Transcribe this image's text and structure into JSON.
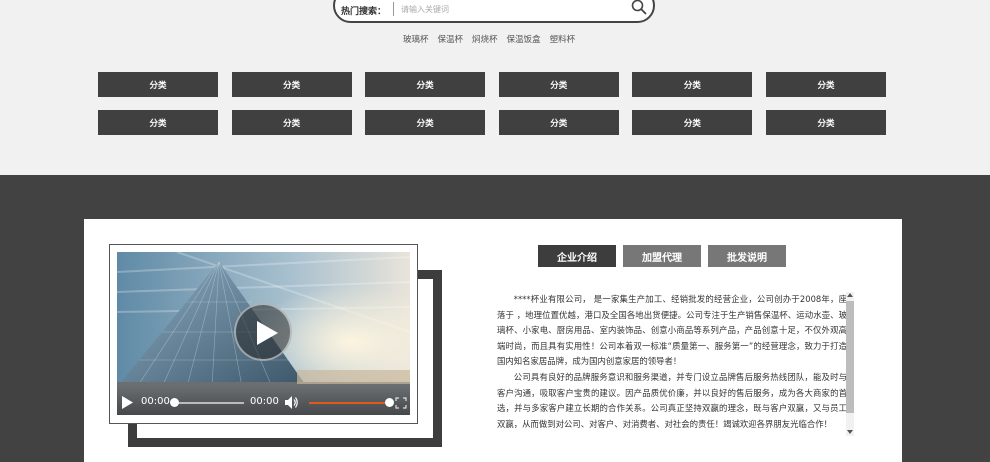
{
  "search": {
    "label": "热门搜索：",
    "placeholder": "请输入关键词",
    "hotwords": [
      "玻璃杯",
      "保温杯",
      "焖烧杯",
      "保温饭盒",
      "塑料杯"
    ]
  },
  "categories": {
    "rows": [
      [
        "分类",
        "分类",
        "分类",
        "分类",
        "分类",
        "分类"
      ],
      [
        "分类",
        "分类",
        "分类",
        "分类",
        "分类",
        "分类"
      ]
    ]
  },
  "video": {
    "current_time": "00:00",
    "duration": "00:00",
    "progress": 0,
    "volume": 1.0
  },
  "tabs": [
    {
      "label": "企业介绍",
      "active": true
    },
    {
      "label": "加盟代理",
      "active": false
    },
    {
      "label": "批发说明",
      "active": false
    }
  ],
  "intro": {
    "paragraphs": [
      "****杯业有限公司， 是一家集生产加工、经销批发的经营企业，公司创办于2008年，座落于 ，地理位置优越，港口及全国各地出货便捷。公司专注于生产销售保温杯、运动水壶、玻璃杯、小家电、厨房用品、室内装饰品、创意小商品等系列产品，产品创意十足，不仅外观高端时尚，而且具有实用性！公司本着双一标准“质量第一、服务第一”的经营理念，致力于打造国内知名家居品牌，成为国内创意家居的领导者！",
      "公司具有良好的品牌服务意识和服务渠道，并专门设立品牌售后服务热线团队，能及时与客户沟通，吸取客户宝贵的建议。因产品质优价廉，并以良好的售后服务，成为各大商家的首选，并与多家客户建立长期的合作关系。公司真正坚持双赢的理念，既与客户双赢，又与员工双赢，从而做到对公司、对客户、对消费者、对社会的责任！竭诚欢迎各界朋友光临合作！"
    ]
  },
  "colors": {
    "dark_bg": "#424242",
    "button_bg": "#404040",
    "tab_active": "#3d3d3d",
    "tab_inactive": "#777777",
    "volume_accent": "#e05a1a",
    "page_bg": "#f0f1f0"
  }
}
